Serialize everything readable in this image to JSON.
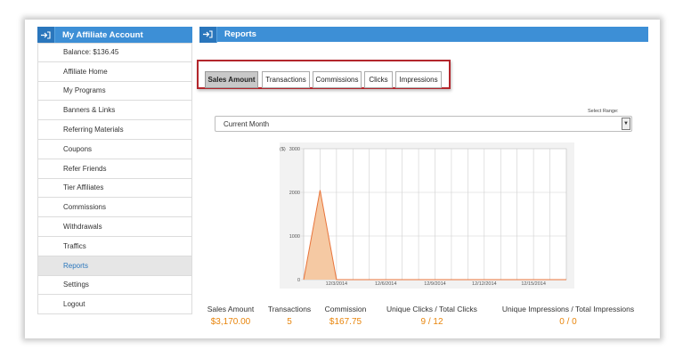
{
  "sidebar": {
    "title": "My Affiliate Account",
    "items": [
      {
        "label": "Balance: $136.45",
        "name": "sidebar-item-balance"
      },
      {
        "label": "Affiliate Home",
        "name": "sidebar-item-affiliate-home"
      },
      {
        "label": "My Programs",
        "name": "sidebar-item-my-programs"
      },
      {
        "label": "Banners & Links",
        "name": "sidebar-item-banners-links"
      },
      {
        "label": "Referring Materials",
        "name": "sidebar-item-referring-materials"
      },
      {
        "label": "Coupons",
        "name": "sidebar-item-coupons"
      },
      {
        "label": "Refer Friends",
        "name": "sidebar-item-refer-friends"
      },
      {
        "label": "Tier Affiliates",
        "name": "sidebar-item-tier-affiliates"
      },
      {
        "label": "Commissions",
        "name": "sidebar-item-commissions"
      },
      {
        "label": "Withdrawals",
        "name": "sidebar-item-withdrawals"
      },
      {
        "label": "Traffics",
        "name": "sidebar-item-traffics"
      },
      {
        "label": "Reports",
        "name": "sidebar-item-reports",
        "active": true
      },
      {
        "label": "Settings",
        "name": "sidebar-item-settings"
      },
      {
        "label": "Logout",
        "name": "sidebar-item-logout"
      }
    ]
  },
  "main": {
    "title": "Reports",
    "tabs": [
      {
        "label": "Sales Amount",
        "active": true
      },
      {
        "label": "Transactions"
      },
      {
        "label": "Commissions"
      },
      {
        "label": "Clicks"
      },
      {
        "label": "Impressions"
      }
    ],
    "range_label": "Select Range:",
    "range_value": "Current Month"
  },
  "stats": [
    {
      "label": "Sales Amount",
      "value": "$3,170.00"
    },
    {
      "label": "Transactions",
      "value": "5"
    },
    {
      "label": "Commission",
      "value": "$167.75"
    },
    {
      "label": "Unique Clicks / Total Clicks",
      "value": "9 / 12"
    },
    {
      "label": "Unique Impressions / Total Impressions",
      "value": "0 / 0"
    }
  ],
  "colors": {
    "accent": "#3d8fd6",
    "value": "#e8850c",
    "area_fill": "#f5c9a3",
    "area_line": "#e8743b",
    "highlight_border": "#b3262c"
  },
  "chart_data": {
    "type": "area",
    "y_unit": "($)",
    "ylim": [
      0,
      3000
    ],
    "yticks": [
      0,
      1000,
      2000,
      3000
    ],
    "xticks": [
      "12/3/2014",
      "12/6/2014",
      "12/9/2014",
      "12/12/2014",
      "12/15/2014"
    ],
    "x": [
      "12/1/2014",
      "12/2/2014",
      "12/3/2014",
      "12/4/2014",
      "12/5/2014",
      "12/6/2014",
      "12/7/2014",
      "12/8/2014",
      "12/9/2014",
      "12/10/2014",
      "12/11/2014",
      "12/12/2014",
      "12/13/2014",
      "12/14/2014",
      "12/15/2014",
      "12/16/2014",
      "12/17/2014"
    ],
    "values": [
      0,
      2050,
      0,
      0,
      0,
      0,
      0,
      0,
      0,
      0,
      0,
      0,
      0,
      0,
      0,
      0,
      0
    ],
    "grid": true
  }
}
